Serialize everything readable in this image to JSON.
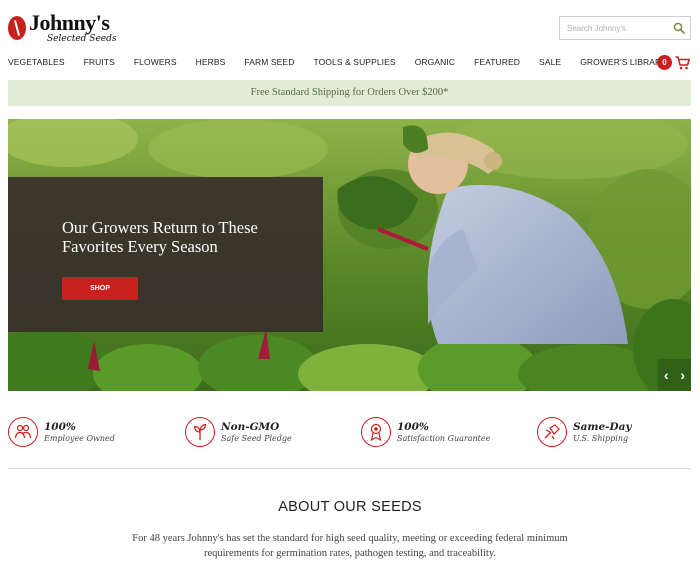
{
  "header": {
    "logo_main": "Johnny's",
    "logo_sub": "Selected Seeds",
    "search_placeholder": "Search Johnny's"
  },
  "nav": {
    "items": [
      "VEGETABLES",
      "FRUITS",
      "FLOWERS",
      "HERBS",
      "FARM SEED",
      "TOOLS & SUPPLIES",
      "ORGANIC",
      "FEATURED",
      "SALE",
      "GROWER'S LIBRARY"
    ],
    "cart_count": "0"
  },
  "shipping_banner": "Free Standard Shipping for Orders Over $200*",
  "hero": {
    "title": "Our Growers Return to These Favorites Every Season",
    "button_label": "SHOP",
    "prev": "‹",
    "next": "›"
  },
  "features": [
    {
      "title": "100%",
      "sub": "Employee Owned",
      "icon": "people-icon"
    },
    {
      "title": "Non-GMO",
      "sub": "Safe Seed Pledge",
      "icon": "sprout-icon"
    },
    {
      "title": "100%",
      "sub": "Satisfaction Guarantee",
      "icon": "ribbon-badge-icon"
    },
    {
      "title": "Same-Day",
      "sub": "U.S. Shipping",
      "icon": "shipping-icon"
    }
  ],
  "about": {
    "title": "ABOUT OUR SEEDS",
    "body": "For 48 years Johnny's has set the standard for high seed quality, meeting or exceeding federal minimum requirements for germination rates, pathogen testing, and traceability."
  },
  "colors": {
    "brand_red": "#c8201e",
    "shipping_bg": "#e2ecd6",
    "shipping_text": "#556b43",
    "hero_panel": "#372f2a"
  }
}
